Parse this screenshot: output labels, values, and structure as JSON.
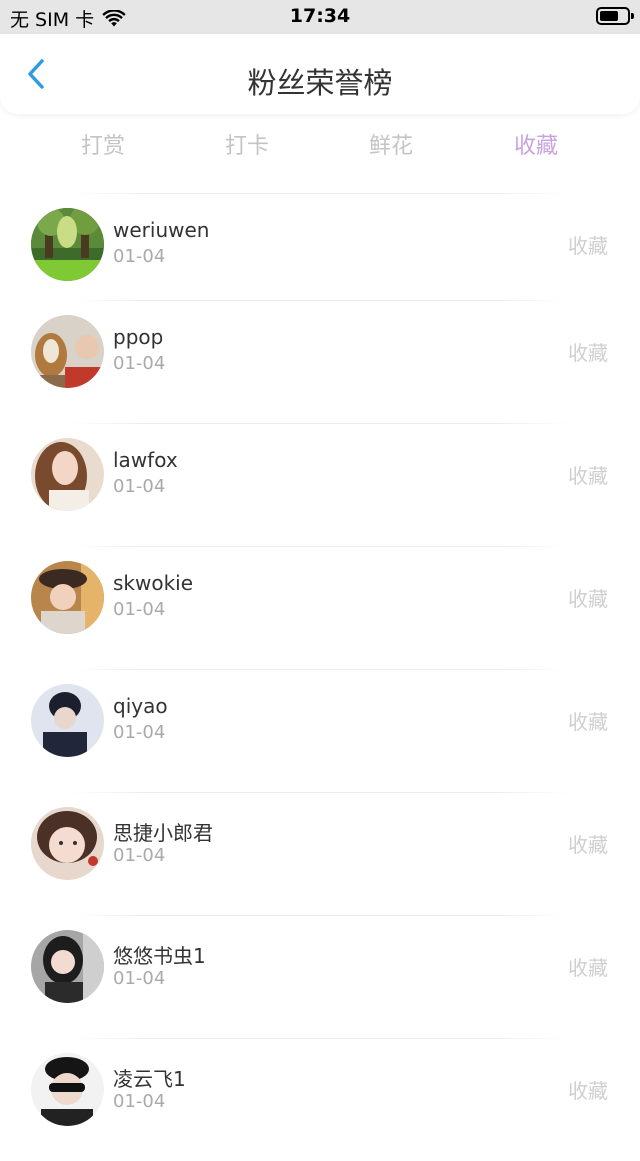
{
  "status_bar": {
    "carrier": "无 SIM 卡",
    "time": "17:34"
  },
  "nav": {
    "title": "粉丝荣誉榜"
  },
  "tabs": [
    {
      "label": "打赏",
      "active": false
    },
    {
      "label": "打卡",
      "active": false
    },
    {
      "label": "鲜花",
      "active": false
    },
    {
      "label": "收藏",
      "active": true
    }
  ],
  "colors": {
    "active_tab": "#c9a3e0",
    "back_arrow": "#2e9be6",
    "muted": "#c4c4c4"
  },
  "fans": [
    {
      "name": "weriuwen",
      "date": "01-04",
      "action": "收藏",
      "avatar": "forest-photo"
    },
    {
      "name": "ppop",
      "date": "01-04",
      "action": "收藏",
      "avatar": "dog-photo"
    },
    {
      "name": "lawfox",
      "date": "01-04",
      "action": "收藏",
      "avatar": "portrait-photo"
    },
    {
      "name": "skwokie",
      "date": "01-04",
      "action": "收藏",
      "avatar": "hat-portrait-photo"
    },
    {
      "name": "qiyao",
      "date": "01-04",
      "action": "收藏",
      "avatar": "dark-portrait-photo"
    },
    {
      "name": "思捷小郎君",
      "date": "01-04",
      "action": "收藏",
      "avatar": "face-photo"
    },
    {
      "name": "悠悠书虫1",
      "date": "01-04",
      "action": "收藏",
      "avatar": "selfie-photo"
    },
    {
      "name": "凌云飞1",
      "date": "01-04",
      "action": "收藏",
      "avatar": "sunglasses-photo"
    }
  ]
}
